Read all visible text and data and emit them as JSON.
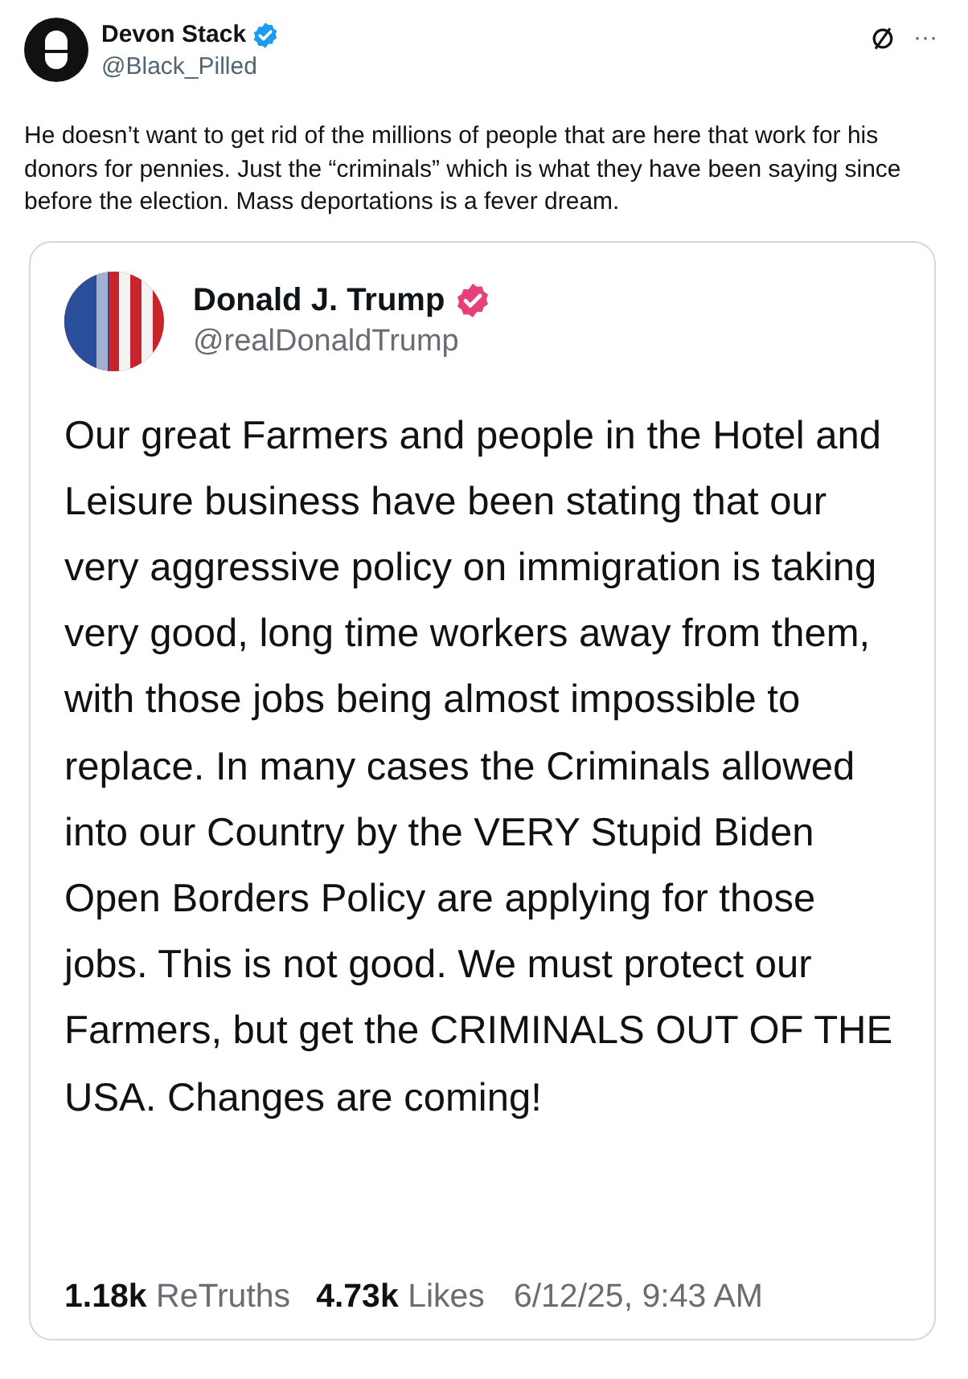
{
  "post": {
    "author": {
      "name": "Devon Stack",
      "handle": "@Black_Pilled",
      "verified": true
    },
    "text": "He doesn’t want to get rid of the millions of people that are here that work for his donors for pennies. Just the “criminals” which is what they have been saying since before the election. Mass deportations is a fever dream.",
    "more_button": "···"
  },
  "quoted": {
    "author": {
      "name": "Donald J. Trump",
      "handle": "@realDonaldTrump",
      "verified": true
    },
    "text": "Our great Farmers and people in the Hotel and Leisure business have been stating that our very aggressive policy on immigration is taking very good, long time workers away from them, with those jobs being almost impossible to replace. In many cases the Criminals allowed into our Country by the VERY Stupid Biden Open Borders Policy are applying for those jobs. This is not good. We must protect our Farmers, but get the CRIMINALS OUT OF THE USA. Changes are coming!",
    "stats": [
      {
        "count": "1.18k",
        "label": "ReTruths"
      },
      {
        "count": "4.73k",
        "label": "Likes"
      }
    ],
    "timestamp": "6/12/25, 9:43 AM"
  }
}
